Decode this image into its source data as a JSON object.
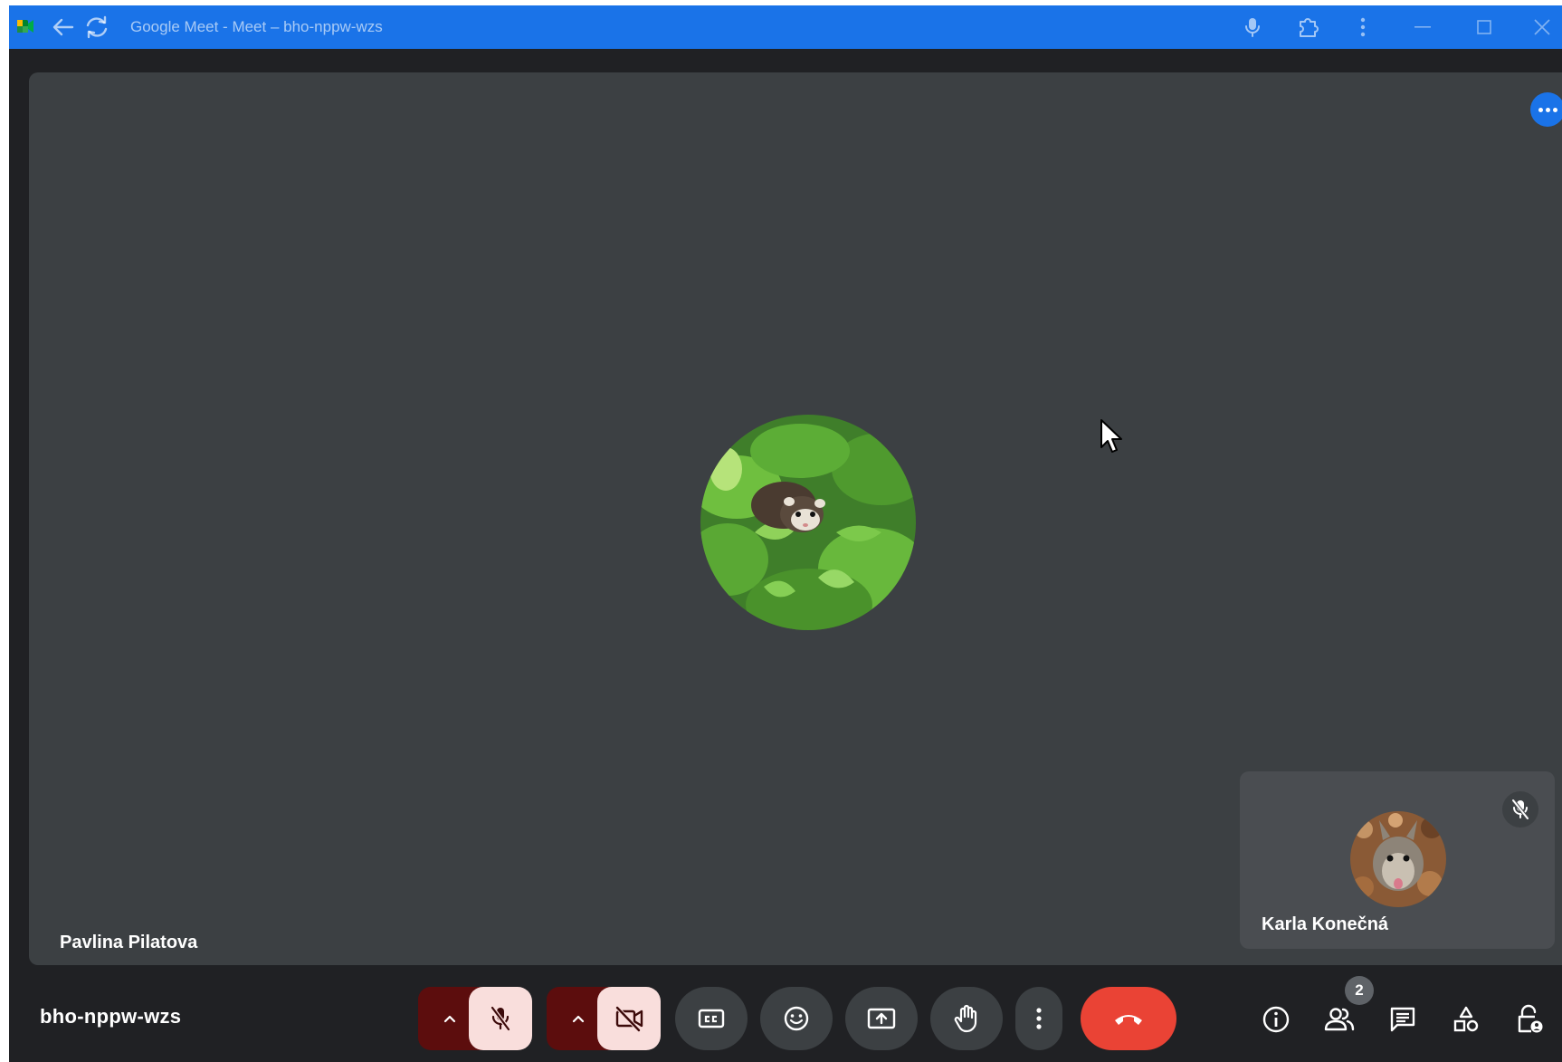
{
  "window": {
    "title": "Google Meet - Meet – bho-nppw-wzs",
    "accent_color": "#1a73e8"
  },
  "titlebar_icons": [
    "back-arrow-icon",
    "reload-icon",
    "microphone-icon",
    "extensions-icon",
    "menu-kebab-icon",
    "minimize-icon",
    "maximize-icon",
    "close-icon"
  ],
  "stage": {
    "presenter_name": "Pavlina Pilatova",
    "presenter_avatar": "ferret-in-plants-photo",
    "more_options_icon": "more-horizontal-icon"
  },
  "self_view": {
    "name": "Karla Konečná",
    "avatar": "squirrel-photo",
    "muted_icon": "mic-off-icon"
  },
  "bottom_bar": {
    "meeting_code": "bho-nppw-wzs",
    "participant_count": "2",
    "controls": [
      "mic-off-icon",
      "camera-off-icon",
      "captions-icon",
      "emoji-icon",
      "present-screen-icon",
      "raise-hand-icon",
      "more-vertical-icon",
      "hang-up-icon"
    ],
    "side_controls": [
      "info-icon",
      "people-icon",
      "chat-icon",
      "activities-icon",
      "host-controls-icon"
    ],
    "colors": {
      "hangup": "#ea4335",
      "toggle_off": "#f9dedc",
      "toggle_off_caret": "#5c0d0d",
      "button_bg": "#3c4043"
    }
  }
}
